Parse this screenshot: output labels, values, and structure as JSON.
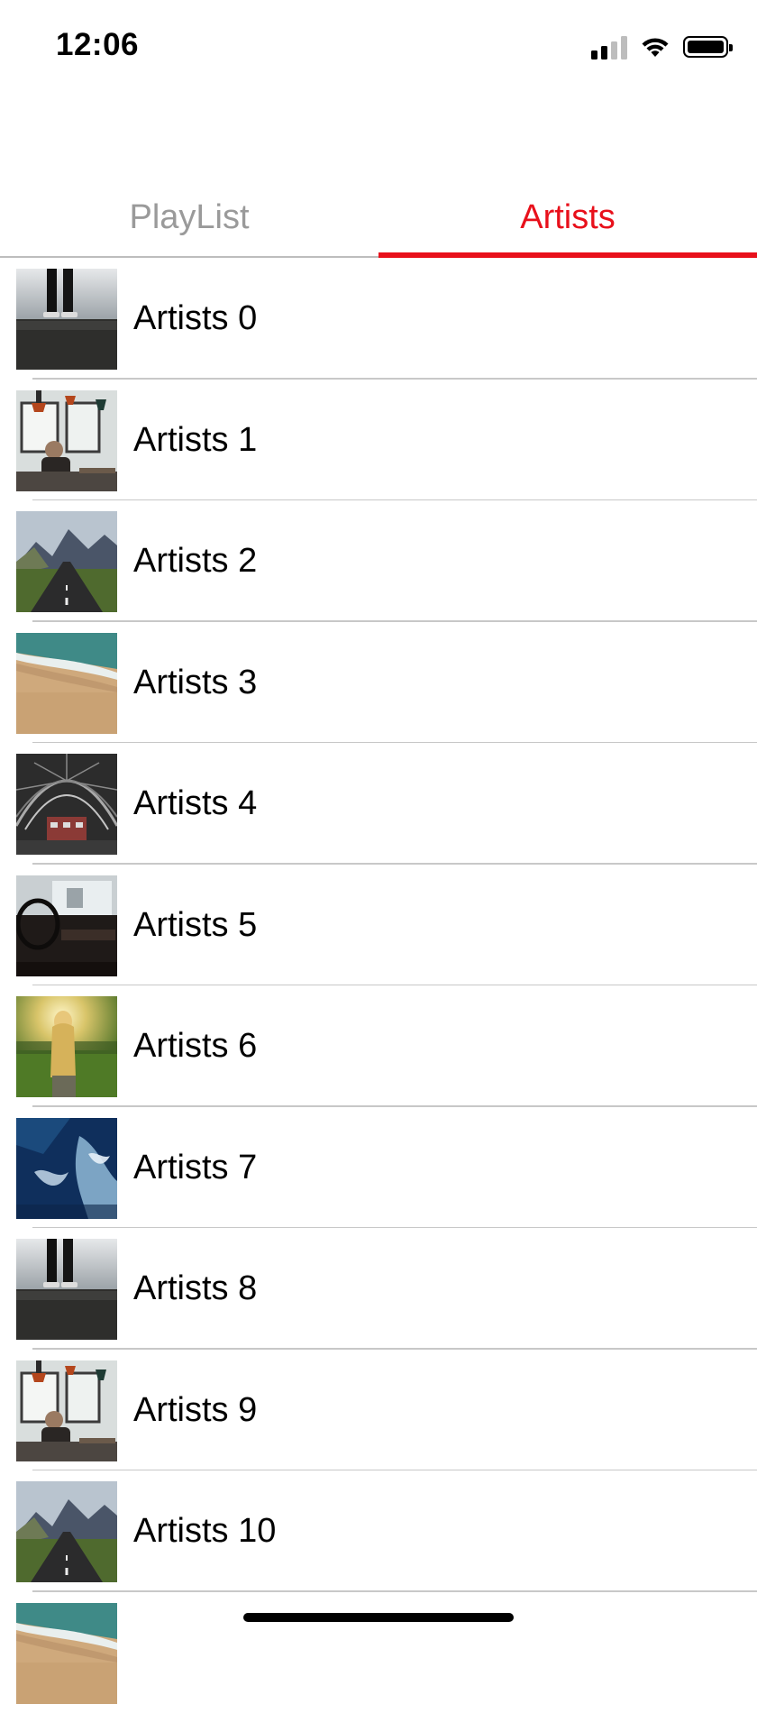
{
  "status_bar": {
    "time": "12:06",
    "signal_icon": "cellular-signal-icon",
    "wifi_icon": "wifi-icon",
    "battery_icon": "battery-icon"
  },
  "tabs": [
    {
      "label": "PlayList",
      "selected": false
    },
    {
      "label": "Artists",
      "selected": true
    }
  ],
  "colors": {
    "accent": "#e8101b",
    "inactive_tab": "#9a9a9a",
    "separator": "#c8c8c8"
  },
  "artists": [
    {
      "label": "Artists 0",
      "image": "person-standing-on-ledge"
    },
    {
      "label": "Artists 1",
      "image": "person-in-cafe"
    },
    {
      "label": "Artists 2",
      "image": "mountain-road"
    },
    {
      "label": "Artists 3",
      "image": "ocean-beach-aerial"
    },
    {
      "label": "Artists 4",
      "image": "train-station-hall"
    },
    {
      "label": "Artists 5",
      "image": "car-interior"
    },
    {
      "label": "Artists 6",
      "image": "woman-in-field-sunset"
    },
    {
      "label": "Artists 7",
      "image": "ocean-water-aerial"
    },
    {
      "label": "Artists 8",
      "image": "person-standing-on-ledge"
    },
    {
      "label": "Artists 9",
      "image": "person-in-cafe"
    },
    {
      "label": "Artists 10",
      "image": "mountain-road"
    },
    {
      "label": "",
      "image": "ocean-beach-aerial"
    }
  ]
}
